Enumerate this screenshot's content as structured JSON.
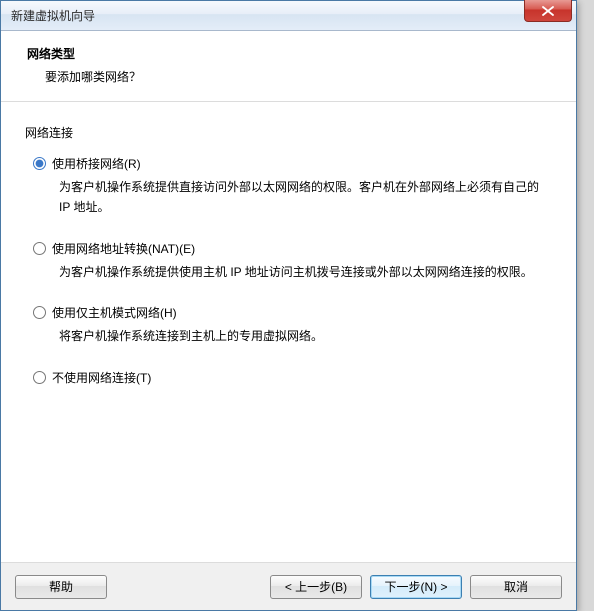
{
  "window": {
    "title": "新建虚拟机向导"
  },
  "header": {
    "title": "网络类型",
    "subtitle": "要添加哪类网络？"
  },
  "section": {
    "label": "网络连接"
  },
  "options": {
    "bridged": {
      "label": "使用桥接网络(R)",
      "desc": "为客户机操作系统提供直接访问外部以太网网络的权限。客户机在外部网络上必须有自己的 IP 地址。"
    },
    "nat": {
      "label": "使用网络地址转换(NAT)(E)",
      "desc": "为客户机操作系统提供使用主机 IP 地址访问主机拨号连接或外部以太网网络连接的权限。"
    },
    "hostonly": {
      "label": "使用仅主机模式网络(H)",
      "desc": "将客户机操作系统连接到主机上的专用虚拟网络。"
    },
    "none": {
      "label": "不使用网络连接(T)"
    }
  },
  "buttons": {
    "help": "帮助",
    "back": "< 上一步(B)",
    "next": "下一步(N) >",
    "cancel": "取消"
  }
}
